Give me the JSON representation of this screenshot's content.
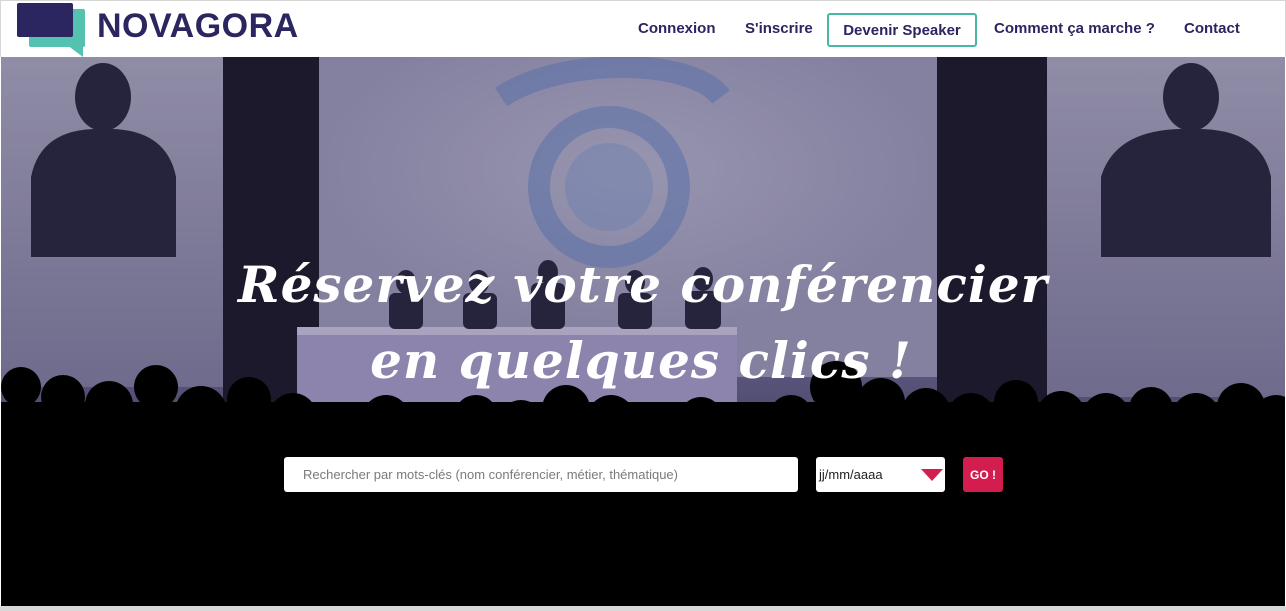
{
  "header": {
    "logo_text": "NOVAGORA",
    "nav": {
      "connexion": "Connexion",
      "inscrire": "S'inscrire",
      "speaker_button": "Devenir Speaker",
      "comment": "Comment ça marche ?",
      "contact": "Contact"
    }
  },
  "hero": {
    "tagline_line1": "Réservez votre conférencier",
    "tagline_line2": "en quelques clics !",
    "search": {
      "placeholder": "Rechercher par mots-clés (nom conférencier, métier, thématique)",
      "value": ""
    },
    "date": {
      "placeholder": "jj/mm/aaaa"
    },
    "go_label": "GO !"
  },
  "colors": {
    "brand": "#2b2560",
    "accent_teal": "#47b8a6",
    "accent_red": "#d31d4f"
  },
  "icons": {
    "logo": "speech-bubble-logo-icon",
    "date_dropdown": "triangle-down-icon"
  }
}
